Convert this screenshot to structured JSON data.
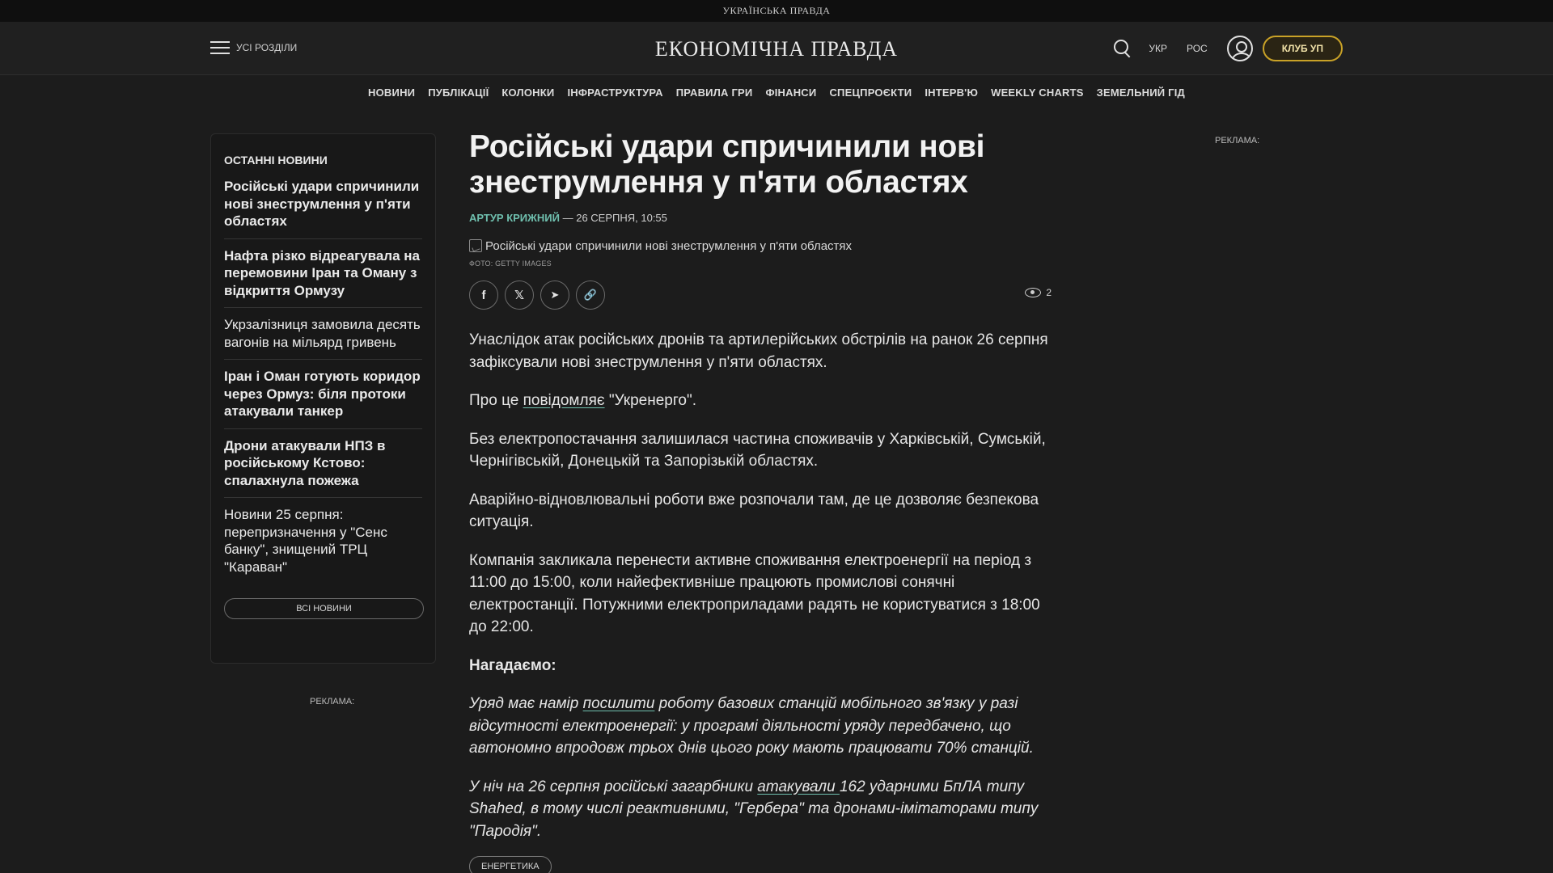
{
  "topstrip": {
    "brand": "УКРАЇНСЬКА ПРАВДА"
  },
  "header": {
    "menu_label": "УСІ РОЗДІЛИ",
    "logo": "ЕКОНОМІЧНА ПРАВДА",
    "lang_ukr": "УКР",
    "lang_ros": "РОС",
    "club_label": "КЛУБ УП"
  },
  "nav": {
    "items": [
      {
        "label": "НОВИНИ"
      },
      {
        "label": "ПУБЛІКАЦІЇ"
      },
      {
        "label": "КОЛОНКИ"
      },
      {
        "label": "ІНФРАСТРУКТУРА"
      },
      {
        "label": "ПРАВИЛА ГРИ"
      },
      {
        "label": "ФІНАНСИ"
      },
      {
        "label": "СПЕЦПРОЄКТИ"
      },
      {
        "label": "ІНТЕРВ'Ю"
      },
      {
        "label": "WEEKLY CHARTS"
      },
      {
        "label": "ЗЕМЕЛЬНИЙ ГІД"
      }
    ]
  },
  "sidebar": {
    "title": "ОСТАННІ НОВИНИ",
    "items": [
      {
        "title": "Російські удари спричинили нові знеструмлення у п'яти областях"
      },
      {
        "title": "Нафта різко відреагувала на перемовини Іран та Оману з відкриття Ормузу"
      },
      {
        "title": "Укрзалізниця замовила десять вагонів на мільярд гривень"
      },
      {
        "title": "Іран і Оман готують коридор через Ормуз: біля протоки атакували танкер"
      },
      {
        "title": "Дрони атакували НПЗ в російському Кстово: спалахнула пожежа"
      },
      {
        "title": "Новини 25 серпня: перепризначення у \"Сенс банку\", знищений ТРЦ \"Караван\""
      }
    ],
    "all_news": "ВСІ НОВИНИ"
  },
  "ads": {
    "label_left": "РЕКЛАМА:",
    "label_right": "РЕКЛАМА:"
  },
  "article": {
    "title": "Російські удари спричинили нові знеструмлення у п'яти областях",
    "author": "АРТУР КРИЖНИЙ",
    "date_sep": " — ",
    "date": "26 СЕРПНЯ, 10:55",
    "image_alt": "Російські удари спричинили нові знеструмлення у п'яти областях",
    "photo_credit": "ФОТО: GETTY IMAGES",
    "share": {
      "facebook": "f",
      "x": "𝕏",
      "telegram": "➤",
      "copy": "🔗"
    },
    "views": "2",
    "p1": "Унаслідок атак російських дронів та артилерійських обстрілів на ранок 26 серпня зафіксували нові знеструмлення у п'яти областях.",
    "p2_a": "Про це ",
    "p2_link": "повідомляє",
    "p2_b": " \"Укренерго\".",
    "p3": "Без електропостачання залишилася частина споживачів у Харківській, Сумській, Чернігівській, Донецькій та Запорізькій областях.",
    "p4": "Аварійно-відновлювальні роботи вже розпочали там, де це дозволяє безпекова ситуація.",
    "p5": "Компанія закликала перенести активне споживання електроенергії на період з 11:00 до 15:00, коли найефективніше працюють промислові сонячні електростанції. Потужними електроприладами радять не користуватися з 18:00 до 22:00.",
    "reminder": "Нагадаємо:",
    "p6_a": "Уряд має намір ",
    "p6_link": "посилити",
    "p6_b": " роботу базових станцій мобільного зв'язку у разі відсутності електроенергії: у програмі діяльності уряду передбачено, що автономно впродовж трьох днів цього року мають працювати 70% станцій.",
    "p7_a": "У ніч на 26 серпня російські загарбники ",
    "p7_link": "атакували ",
    "p7_b": "162 ударними БпЛА типу Shahed, в тому числі реактивними, \"Гербера\" та дронами-імітаторами типу \"Пародія\".",
    "tag": "ЕНЕРГЕТИКА"
  }
}
